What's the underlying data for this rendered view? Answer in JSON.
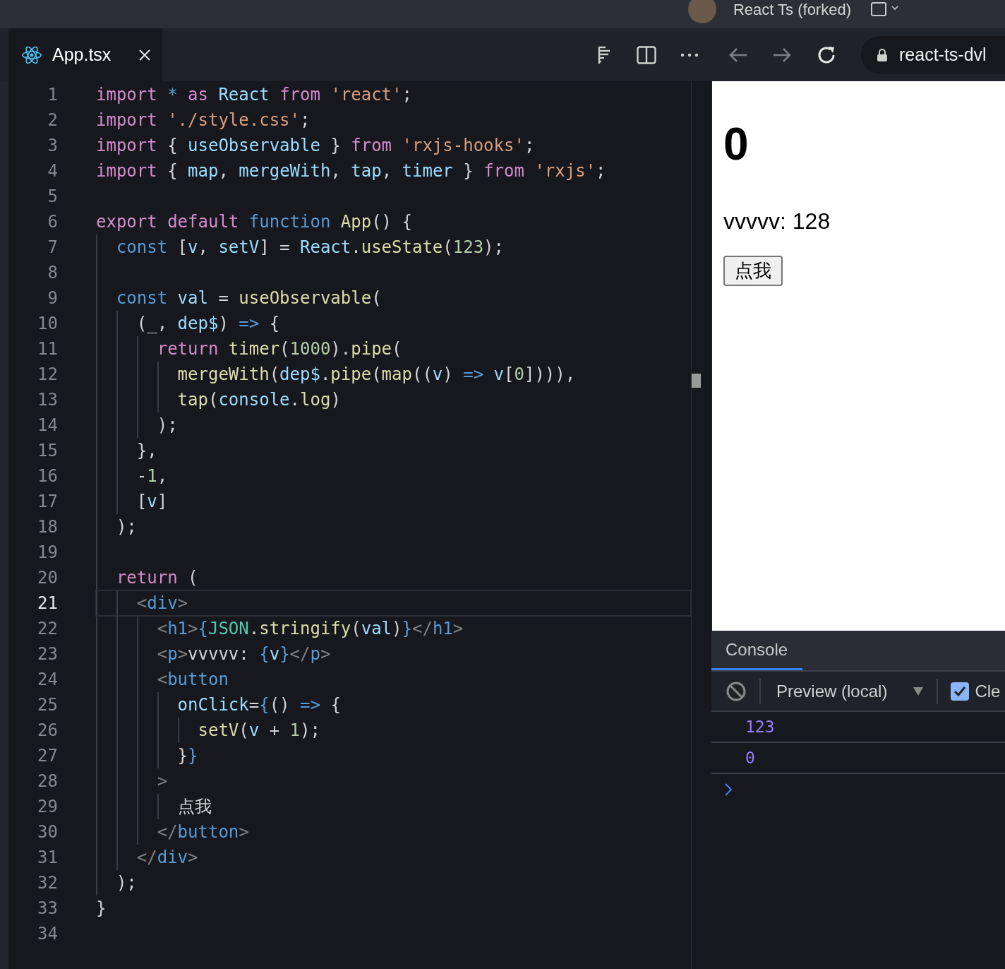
{
  "window": {
    "title": "React Ts (forked)"
  },
  "tabs": [
    {
      "label": "App.tsx",
      "selected": true
    }
  ],
  "browser": {
    "nav": [
      {
        "kind": "back",
        "disabled": true
      },
      {
        "kind": "forward",
        "disabled": true
      },
      {
        "kind": "reload",
        "disabled": false
      }
    ],
    "address": "react-ts-dvl"
  },
  "editor": {
    "lines": [
      {
        "number": "1",
        "current": false,
        "tokens": [
          {
            "kind": "keyword",
            "text": "import "
          },
          {
            "kind": "storage",
            "text": "* "
          },
          {
            "kind": "keyword",
            "text": "as "
          },
          {
            "kind": "variable",
            "text": "React "
          },
          {
            "kind": "keyword",
            "text": "from "
          },
          {
            "kind": "string",
            "text": "'react'"
          },
          {
            "kind": "plain",
            "text": ";"
          }
        ]
      },
      {
        "number": "2",
        "current": false,
        "tokens": [
          {
            "kind": "keyword",
            "text": "import "
          },
          {
            "kind": "string",
            "text": "'./style.css'"
          },
          {
            "kind": "plain",
            "text": ";"
          }
        ]
      },
      {
        "number": "3",
        "current": false,
        "tokens": [
          {
            "kind": "keyword",
            "text": "import "
          },
          {
            "kind": "plain",
            "text": "{ "
          },
          {
            "kind": "variable",
            "text": "useObservable "
          },
          {
            "kind": "plain",
            "text": "} "
          },
          {
            "kind": "keyword",
            "text": "from "
          },
          {
            "kind": "string",
            "text": "'rxjs-hooks'"
          },
          {
            "kind": "plain",
            "text": ";"
          }
        ]
      },
      {
        "number": "4",
        "current": false,
        "tokens": [
          {
            "kind": "keyword",
            "text": "import "
          },
          {
            "kind": "plain",
            "text": "{ "
          },
          {
            "kind": "variable",
            "text": "map"
          },
          {
            "kind": "plain",
            "text": ", "
          },
          {
            "kind": "variable",
            "text": "mergeWith"
          },
          {
            "kind": "plain",
            "text": ", "
          },
          {
            "kind": "variable",
            "text": "tap"
          },
          {
            "kind": "plain",
            "text": ", "
          },
          {
            "kind": "variable",
            "text": "timer "
          },
          {
            "kind": "plain",
            "text": "} "
          },
          {
            "kind": "keyword",
            "text": "from "
          },
          {
            "kind": "string",
            "text": "'rxjs'"
          },
          {
            "kind": "plain",
            "text": ";"
          }
        ]
      },
      {
        "number": "5",
        "current": false
      },
      {
        "number": "6",
        "current": false,
        "tokens": [
          {
            "kind": "keyword",
            "text": "export default "
          },
          {
            "kind": "storage",
            "text": "function "
          },
          {
            "kind": "function",
            "text": "App"
          },
          {
            "kind": "plain",
            "text": "() {"
          }
        ]
      },
      {
        "number": "7",
        "current": false,
        "tokens": [
          {
            "kind": "storage",
            "text": "  const "
          },
          {
            "kind": "plain",
            "text": "["
          },
          {
            "kind": "variable",
            "text": "v"
          },
          {
            "kind": "plain",
            "text": ", "
          },
          {
            "kind": "variable",
            "text": "setV"
          },
          {
            "kind": "plain",
            "text": "] = "
          },
          {
            "kind": "variable",
            "text": "React"
          },
          {
            "kind": "plain",
            "text": "."
          },
          {
            "kind": "function",
            "text": "useState"
          },
          {
            "kind": "plain",
            "text": "("
          },
          {
            "kind": "number",
            "text": "123"
          },
          {
            "kind": "plain",
            "text": ");"
          }
        ]
      },
      {
        "number": "8",
        "current": false
      },
      {
        "number": "9",
        "current": false,
        "tokens": [
          {
            "kind": "storage",
            "text": "  const "
          },
          {
            "kind": "variable",
            "text": "val "
          },
          {
            "kind": "plain",
            "text": "= "
          },
          {
            "kind": "function",
            "text": "useObservable"
          },
          {
            "kind": "plain",
            "text": "("
          }
        ]
      },
      {
        "number": "10",
        "current": false,
        "tokens": [
          {
            "kind": "plain",
            "text": "    (_, "
          },
          {
            "kind": "variable",
            "text": "dep$"
          },
          {
            "kind": "plain",
            "text": ") "
          },
          {
            "kind": "storage",
            "text": "=> "
          },
          {
            "kind": "plain",
            "text": "{"
          }
        ]
      },
      {
        "number": "11",
        "current": false,
        "tokens": [
          {
            "kind": "keyword",
            "text": "      return "
          },
          {
            "kind": "function",
            "text": "timer"
          },
          {
            "kind": "plain",
            "text": "("
          },
          {
            "kind": "number",
            "text": "1000"
          },
          {
            "kind": "plain",
            "text": ")."
          },
          {
            "kind": "function",
            "text": "pipe"
          },
          {
            "kind": "plain",
            "text": "("
          }
        ]
      },
      {
        "number": "12",
        "current": false,
        "tokens": [
          {
            "kind": "function",
            "text": "        mergeWith"
          },
          {
            "kind": "plain",
            "text": "("
          },
          {
            "kind": "variable",
            "text": "dep$"
          },
          {
            "kind": "plain",
            "text": "."
          },
          {
            "kind": "function",
            "text": "pipe"
          },
          {
            "kind": "plain",
            "text": "("
          },
          {
            "kind": "function",
            "text": "map"
          },
          {
            "kind": "plain",
            "text": "(("
          },
          {
            "kind": "variable",
            "text": "v"
          },
          {
            "kind": "plain",
            "text": ") "
          },
          {
            "kind": "storage",
            "text": "=> "
          },
          {
            "kind": "variable",
            "text": "v"
          },
          {
            "kind": "plain",
            "text": "["
          },
          {
            "kind": "number",
            "text": "0"
          },
          {
            "kind": "plain",
            "text": "]))),"
          }
        ]
      },
      {
        "number": "13",
        "current": false,
        "tokens": [
          {
            "kind": "function",
            "text": "        tap"
          },
          {
            "kind": "plain",
            "text": "("
          },
          {
            "kind": "variable",
            "text": "console"
          },
          {
            "kind": "plain",
            "text": "."
          },
          {
            "kind": "function",
            "text": "log"
          },
          {
            "kind": "plain",
            "text": ")"
          }
        ]
      },
      {
        "number": "14",
        "current": false,
        "tokens": [
          {
            "kind": "plain",
            "text": "      );"
          }
        ]
      },
      {
        "number": "15",
        "current": false,
        "tokens": [
          {
            "kind": "plain",
            "text": "    },"
          }
        ]
      },
      {
        "number": "16",
        "current": false,
        "tokens": [
          {
            "kind": "plain",
            "text": "    -"
          },
          {
            "kind": "number",
            "text": "1"
          },
          {
            "kind": "plain",
            "text": ","
          }
        ]
      },
      {
        "number": "17",
        "current": false,
        "tokens": [
          {
            "kind": "plain",
            "text": "    ["
          },
          {
            "kind": "variable",
            "text": "v"
          },
          {
            "kind": "plain",
            "text": "]"
          }
        ]
      },
      {
        "number": "18",
        "current": false,
        "tokens": [
          {
            "kind": "plain",
            "text": "  );"
          }
        ]
      },
      {
        "number": "19",
        "current": false
      },
      {
        "number": "20",
        "current": false,
        "tokens": [
          {
            "kind": "keyword",
            "text": "  return "
          },
          {
            "kind": "plain",
            "text": "("
          }
        ]
      },
      {
        "number": "21",
        "current": true,
        "tokens": [
          {
            "kind": "punctuation",
            "text": "    <"
          },
          {
            "kind": "tag",
            "text": "div"
          },
          {
            "kind": "punctuation",
            "text": ">"
          }
        ]
      },
      {
        "number": "22",
        "current": false,
        "tokens": [
          {
            "kind": "punctuation",
            "text": "      <"
          },
          {
            "kind": "tag",
            "text": "h1"
          },
          {
            "kind": "punctuation",
            "text": ">"
          },
          {
            "kind": "storage",
            "text": "{"
          },
          {
            "kind": "class",
            "text": "JSON"
          },
          {
            "kind": "plain",
            "text": "."
          },
          {
            "kind": "function",
            "text": "stringify"
          },
          {
            "kind": "plain",
            "text": "("
          },
          {
            "kind": "variable",
            "text": "val"
          },
          {
            "kind": "plain",
            "text": ")"
          },
          {
            "kind": "storage",
            "text": "}"
          },
          {
            "kind": "punctuation",
            "text": "</"
          },
          {
            "kind": "tag",
            "text": "h1"
          },
          {
            "kind": "punctuation",
            "text": ">"
          }
        ]
      },
      {
        "number": "23",
        "current": false,
        "tokens": [
          {
            "kind": "punctuation",
            "text": "      <"
          },
          {
            "kind": "tag",
            "text": "p"
          },
          {
            "kind": "punctuation",
            "text": ">"
          },
          {
            "kind": "plain",
            "text": "vvvvv: "
          },
          {
            "kind": "storage",
            "text": "{"
          },
          {
            "kind": "variable",
            "text": "v"
          },
          {
            "kind": "storage",
            "text": "}"
          },
          {
            "kind": "punctuation",
            "text": "</"
          },
          {
            "kind": "tag",
            "text": "p"
          },
          {
            "kind": "punctuation",
            "text": ">"
          }
        ]
      },
      {
        "number": "24",
        "current": false,
        "tokens": [
          {
            "kind": "punctuation",
            "text": "      <"
          },
          {
            "kind": "tag",
            "text": "button"
          }
        ]
      },
      {
        "number": "25",
        "current": false,
        "tokens": [
          {
            "kind": "variable",
            "text": "        onClick"
          },
          {
            "kind": "plain",
            "text": "="
          },
          {
            "kind": "storage",
            "text": "{"
          },
          {
            "kind": "plain",
            "text": "() "
          },
          {
            "kind": "storage",
            "text": "=> "
          },
          {
            "kind": "plain",
            "text": "{"
          }
        ]
      },
      {
        "number": "26",
        "current": false,
        "tokens": [
          {
            "kind": "function",
            "text": "          setV"
          },
          {
            "kind": "plain",
            "text": "("
          },
          {
            "kind": "variable",
            "text": "v "
          },
          {
            "kind": "plain",
            "text": "+ "
          },
          {
            "kind": "number",
            "text": "1"
          },
          {
            "kind": "plain",
            "text": ");"
          }
        ]
      },
      {
        "number": "27",
        "current": false,
        "tokens": [
          {
            "kind": "plain",
            "text": "        }"
          },
          {
            "kind": "storage",
            "text": "}"
          }
        ]
      },
      {
        "number": "28",
        "current": false,
        "tokens": [
          {
            "kind": "punctuation",
            "text": "      >"
          }
        ]
      },
      {
        "number": "29",
        "current": false,
        "tokens": [
          {
            "kind": "plain",
            "text": "        点我"
          }
        ]
      },
      {
        "number": "30",
        "current": false,
        "tokens": [
          {
            "kind": "punctuation",
            "text": "      </"
          },
          {
            "kind": "tag",
            "text": "button"
          },
          {
            "kind": "punctuation",
            "text": ">"
          }
        ]
      },
      {
        "number": "31",
        "current": false,
        "tokens": [
          {
            "kind": "punctuation",
            "text": "    </"
          },
          {
            "kind": "tag",
            "text": "div"
          },
          {
            "kind": "punctuation",
            "text": ">"
          }
        ]
      },
      {
        "number": "32",
        "current": false,
        "tokens": [
          {
            "kind": "plain",
            "text": "  );"
          }
        ]
      },
      {
        "number": "33",
        "current": false,
        "tokens": [
          {
            "kind": "plain",
            "text": "}"
          }
        ]
      },
      {
        "number": "34",
        "current": false
      }
    ]
  },
  "preview": {
    "heading": "0",
    "paragraph": "vvvvv: 128",
    "button": "点我"
  },
  "console": {
    "tab": {
      "label": "Console",
      "selected": true
    },
    "context": "Preview (local)",
    "clear_option": {
      "label": "Cle",
      "checked": true
    },
    "entries": [
      {
        "text": "123"
      },
      {
        "text": "0"
      }
    ]
  }
}
